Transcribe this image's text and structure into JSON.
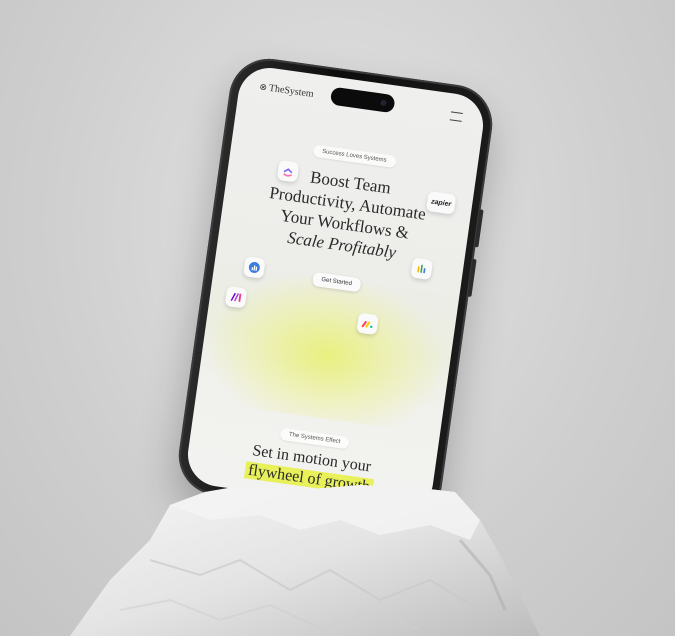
{
  "site": {
    "brand": "TheSystem",
    "brand_mark": "⊗",
    "tagline": "Success Loves Systems",
    "headline": {
      "line1": "Boost Team",
      "line2": "Productivity, Automate",
      "line3": "Your Workflows &",
      "line4": "Scale Profitably"
    },
    "cta_label": "Get Started",
    "section_tag": "The Systems Effect",
    "section_title_line1": "Set in motion your",
    "section_title_line2": "flywheel of growth"
  },
  "icons": {
    "clickup": "clickup-icon",
    "zapier": "zapier",
    "chart": "bar-chart-icon",
    "make": "make-icon",
    "monday": "monday-icon",
    "metrics": "metrics-icon"
  },
  "colors": {
    "highlight": "#e8f05a",
    "background": "#d6d6d6"
  }
}
